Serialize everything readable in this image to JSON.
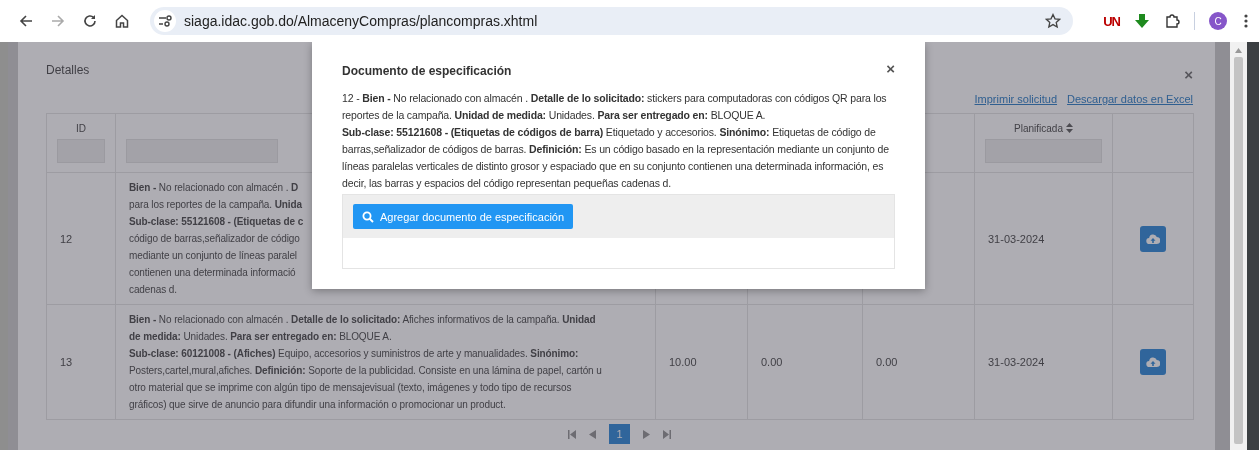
{
  "browser": {
    "url": "siaga.idac.gob.do/AlmacenyCompras/plancompras.xhtml",
    "extension_label": "UN",
    "avatar": "C"
  },
  "panel": {
    "title": "Detalles",
    "close": "×",
    "links": [
      "Imprimir solicitud",
      "Descargar datos en Excel"
    ]
  },
  "table": {
    "columns": [
      {
        "label": "ID",
        "filter": true
      },
      {
        "filter": true
      },
      {},
      {},
      {},
      {
        "label": "Planificada",
        "sortable": true,
        "filter": true
      },
      {}
    ],
    "rows": [
      {
        "id": "12",
        "description_lines": [
          "**Bien -** No relacionado con almacén . **D**",
          "para los reportes de la campaña. **Unida**",
          "**Sub-clase: 55121608 - (Etiquetas de c**",
          "código de barras,señalizador de código",
          "mediante un conjunto de líneas paralel",
          "contienen una determinada informació",
          "cadenas d."
        ],
        "planned": "31-03-2024"
      },
      {
        "id": "13",
        "description_lines": [
          "**Bien -** No relacionado con almacén . **Detalle de lo solicitado:** Afiches informativos de la campaña. **Unidad**",
          "**de medida:** Unidades. **Para ser entregado en:** BLOQUE A.",
          "**Sub-clase: 60121008 - (Afiches)** Equipo, accesorios y suministros de arte y manualidades. **Sinónimo:**",
          "Posters,cartel,mural,afiches. **Definición:** Soporte de la publicidad. Consiste en una lámina de papel, cartón u",
          "otro material que se imprime con algún tipo de mensajevisual (texto, imágenes y todo tipo de recursos",
          "gráficos) que sirve de anuncio para difundir una información o promocionar un product."
        ],
        "column_3": "10.00",
        "column_4": "0.00",
        "column_5": "0.00",
        "planned": "31-03-2024"
      }
    ]
  },
  "pagination": {
    "pages": [
      {
        "label": "1",
        "selected": true
      }
    ]
  },
  "modal": {
    "title": "Documento de especificación",
    "close": "×",
    "paragraphs": [
      "12 - **Bien -** No relacionado con almacén . **Detalle de lo solicitado:** stickers para computadoras con códigos QR para los reportes de la campaña. **Unidad de medida:** Unidades. **Para ser entregado en:** BLOQUE A.",
      "**Sub-clase: 55121608 - (Etiquetas de códigos de barra)** Etiquetado y accesorios. **Sinónimo:** Etiquetas de código de barras,señalizador de códigos de barras. **Definición:** Es un código basado en la representación mediante un conjunto de líneas paralelas verticales de distinto grosor y espaciado que en su conjunto contienen una determinada información, es decir, las barras y espacios del código representan pequeñas cadenas d."
    ],
    "button": "Agregar documento de especificación"
  }
}
